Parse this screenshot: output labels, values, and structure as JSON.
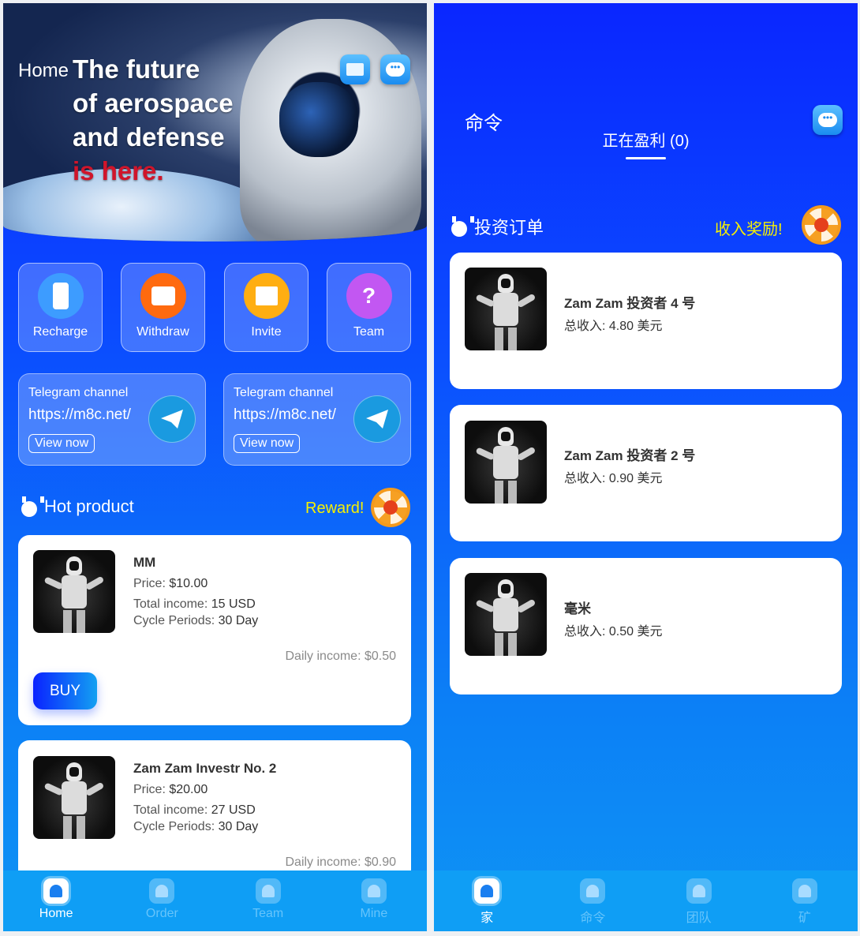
{
  "home": {
    "banner": {
      "home_label": "Home",
      "headline": [
        "The future",
        "of aerospace",
        "and defense"
      ],
      "headline_red": "is here."
    },
    "quick_actions": [
      {
        "label": "Recharge",
        "icon": "phone-icon",
        "color": "#3d9cff"
      },
      {
        "label": "Withdraw",
        "icon": "wallet-icon",
        "color": "#ff6a0f"
      },
      {
        "label": "Invite",
        "icon": "gift-icon",
        "color": "#ffae12"
      },
      {
        "label": "Team",
        "icon": "question-chat-icon",
        "color": "#c257f2"
      }
    ],
    "telegram": [
      {
        "title": "Telegram channel",
        "url": "https://m8c.net/",
        "button": "View now"
      },
      {
        "title": "Telegram channel",
        "url": "https://m8c.net/",
        "button": "View now"
      }
    ],
    "section_title": "Hot product",
    "reward_label": "Reward!",
    "products": [
      {
        "name": "MM",
        "price_label": "Price:",
        "price": "$10.00",
        "income_label": "Total income:",
        "income": "15 USD",
        "cycle_label": "Cycle Periods:",
        "cycle": "30 Day",
        "daily": "Daily income: $0.50",
        "buy": "BUY"
      },
      {
        "name": "Zam Zam Investr No. 2",
        "price_label": "Price:",
        "price": "$20.00",
        "income_label": "Total income:",
        "income": "27 USD",
        "cycle_label": "Cycle Periods:",
        "cycle": "30 Day",
        "daily": "Daily income: $0.90"
      }
    ],
    "nav": [
      {
        "label": "Home",
        "active": true
      },
      {
        "label": "Order"
      },
      {
        "label": "Team"
      },
      {
        "label": "Mine"
      }
    ]
  },
  "orders": {
    "title": "命令",
    "tab": "正在盈利 (0)",
    "section_title": "投资订单",
    "reward_label": "收入奖励!",
    "items": [
      {
        "name": "Zam Zam 投资者 4 号",
        "income": "总收入:  4.80 美元"
      },
      {
        "name": "Zam Zam 投资者 2 号",
        "income": "总收入:  0.90 美元"
      },
      {
        "name": "毫米",
        "income": "总收入:  0.50 美元"
      }
    ],
    "nav": [
      {
        "label": "家",
        "active": true
      },
      {
        "label": "命令"
      },
      {
        "label": "团队"
      },
      {
        "label": "矿"
      }
    ]
  },
  "colors": {
    "accent": "#0a26ff",
    "nav": "#0f9ef5",
    "reward": "#f7f000"
  }
}
